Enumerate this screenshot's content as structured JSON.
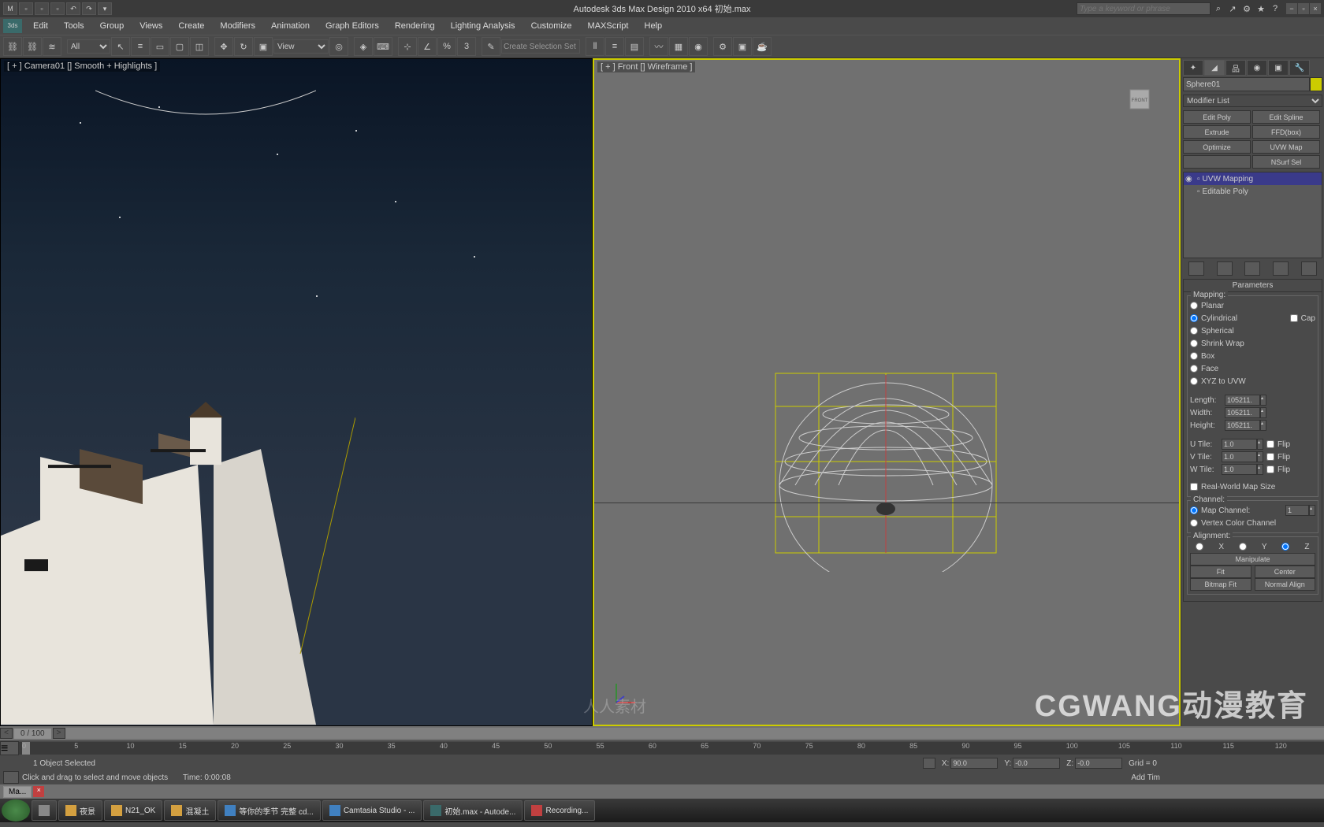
{
  "title": "Autodesk 3ds Max Design 2010 x64    初始.max",
  "search_placeholder": "Type a keyword or phrase",
  "menus": [
    "Edit",
    "Tools",
    "Group",
    "Views",
    "Create",
    "Modifiers",
    "Animation",
    "Graph Editors",
    "Rendering",
    "Lighting Analysis",
    "Customize",
    "MAXScript",
    "Help"
  ],
  "toolbar_all": "All",
  "toolbar_view": "View",
  "toolbar_create_sel": "Create Selection Set",
  "viewport_left_label": "[ + ] Camera01 [] Smooth + Highlights ]",
  "viewport_right_label": "[ + ] Front [] Wireframe ]",
  "cmdpanel": {
    "obj_name": "Sphere01",
    "mod_list": "Modifier List",
    "mod_buttons": [
      "Edit Poly",
      "Edit Spline",
      "Extrude",
      "FFD(box)",
      "Optimize",
      "UVW Map",
      "",
      "NSurf Sel"
    ],
    "stack_items": [
      {
        "icon": "◉",
        "box": "▫",
        "name": "UVW Mapping",
        "sel": true
      },
      {
        "icon": "",
        "box": "▫",
        "name": "Editable Poly",
        "sel": false
      }
    ]
  },
  "params": {
    "header": "Parameters",
    "mapping_label": "Mapping:",
    "mapping_opts": [
      "Planar",
      "Cylindrical",
      "Spherical",
      "Shrink Wrap",
      "Box",
      "Face",
      "XYZ to UVW"
    ],
    "mapping_selected": "Cylindrical",
    "cap_label": "Cap",
    "length_label": "Length:",
    "length_val": "105211.",
    "width_label": "Width:",
    "width_val": "105211.",
    "height_label": "Height:",
    "height_val": "105211.",
    "utile_label": "U Tile:",
    "utile_val": "1.0",
    "vtile_label": "V Tile:",
    "vtile_val": "1.0",
    "wtile_label": "W Tile:",
    "wtile_val": "1.0",
    "flip_label": "Flip",
    "realworld_label": "Real-World Map Size",
    "channel_label": "Channel:",
    "mapchannel_label": "Map Channel:",
    "mapchannel_val": "1",
    "vertexcolor_label": "Vertex Color Channel",
    "alignment_label": "Alignment:",
    "align_opts": [
      "X",
      "Y",
      "Z"
    ],
    "manipulate_label": "Manipulate",
    "fit_label": "Fit",
    "center_label": "Center",
    "bitmapfit_label": "Bitmap Fit",
    "normalalign_label": "Normal Align"
  },
  "timeline": {
    "current": "0 / 100",
    "ticks": [
      0,
      5,
      10,
      15,
      20,
      25,
      30,
      35,
      40,
      45,
      50,
      55,
      60,
      65,
      70,
      75,
      80,
      85,
      90,
      95,
      100,
      105,
      110,
      115,
      120
    ]
  },
  "status": {
    "selected": "1 Object Selected",
    "x_label": "X:",
    "x_val": "90.0",
    "y_label": "Y:",
    "y_val": "-0.0",
    "z_label": "Z:",
    "z_val": "-0.0",
    "grid": "Grid = 0",
    "addtime": "Add Tim",
    "rendertime": "Time: 0:00:08"
  },
  "prompt_label": "Click and drag to select and move objects",
  "taskbar_items": [
    "Ma...",
    "夜景",
    "N21_OK",
    "混凝土",
    "等你的季节 完整 cd...",
    "Camtasia Studio - ...",
    "初始.max - Autode...",
    "Recording..."
  ],
  "watermark": "CGWANG动漫教育",
  "watermark2": "人人素材"
}
